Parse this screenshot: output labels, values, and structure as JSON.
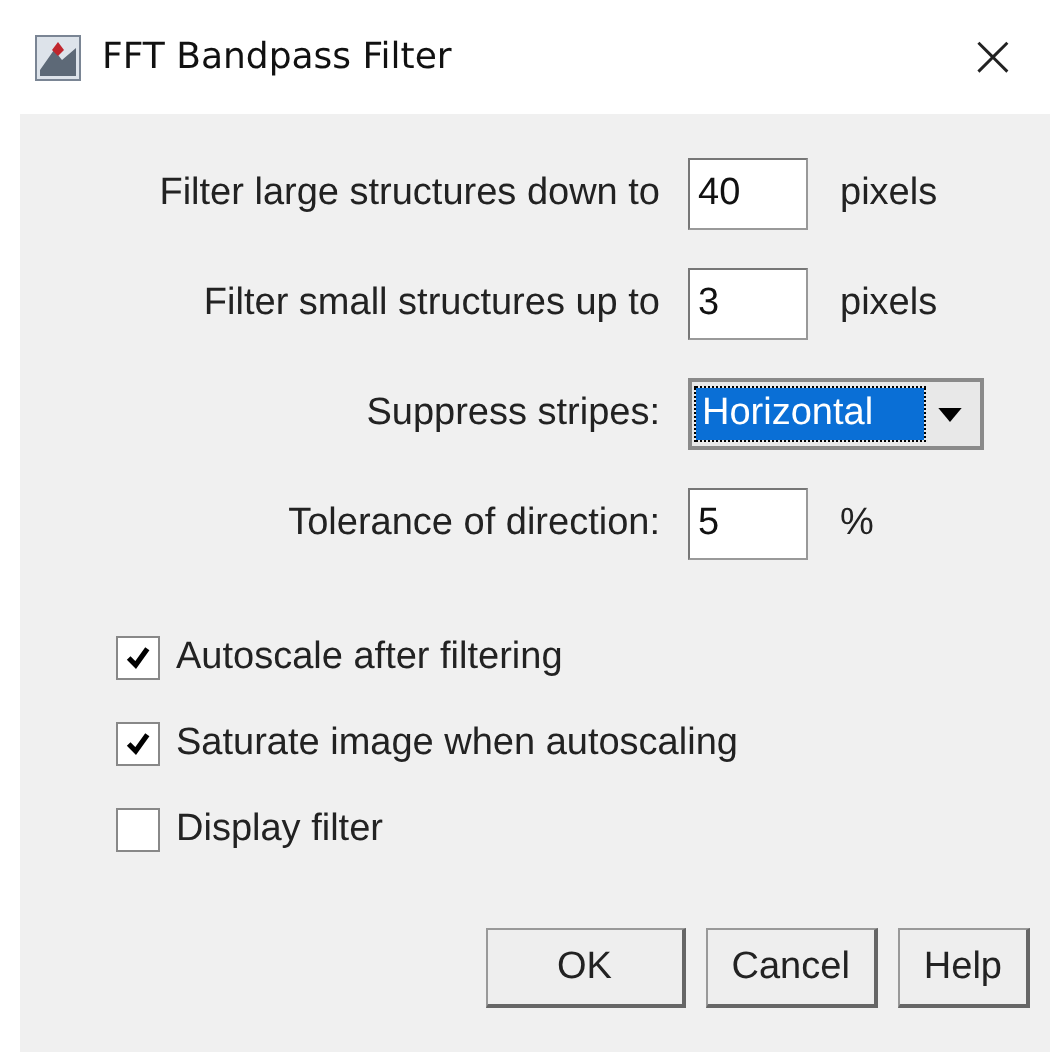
{
  "window": {
    "title": "FFT Bandpass Filter",
    "close": "×"
  },
  "fields": [
    {
      "kind": "text",
      "label": "Filter large structures down to",
      "value": "40",
      "unit": "pixels"
    },
    {
      "kind": "text",
      "label": "Filter small structures up to",
      "value": "3",
      "unit": "pixels"
    },
    {
      "kind": "dropdown",
      "label": "Suppress stripes:",
      "value": "Horizontal"
    },
    {
      "kind": "text",
      "label": "Tolerance of direction:",
      "value": "5",
      "unit": "%"
    }
  ],
  "checkboxes": [
    {
      "label": "Autoscale after filtering",
      "checked": true
    },
    {
      "label": "Saturate image when autoscaling",
      "checked": true
    },
    {
      "label": "Display filter",
      "checked": false
    }
  ],
  "buttons": [
    "OK",
    "Cancel",
    "Help"
  ]
}
